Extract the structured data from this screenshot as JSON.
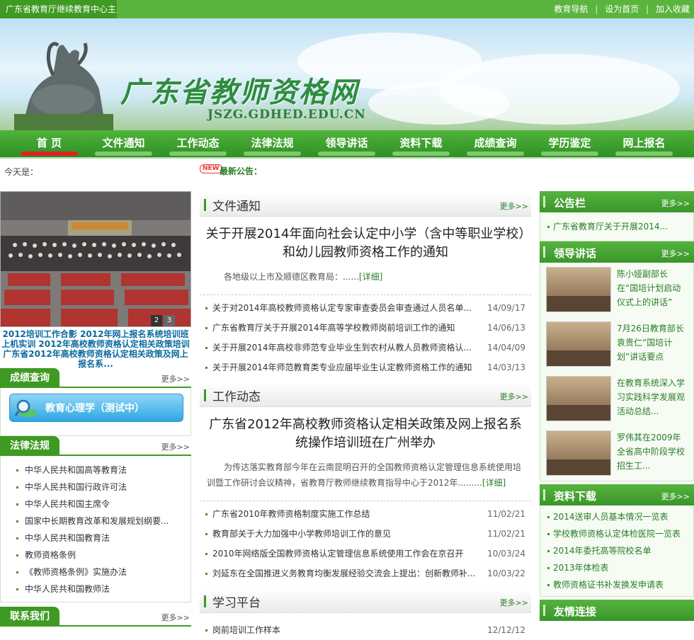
{
  "topbar": {
    "host_text": "广东省教育厅继续教育中心主办",
    "links": [
      "教育导航",
      "设为首页",
      "加入收藏"
    ]
  },
  "banner": {
    "site_name": "广东省教师资格网",
    "site_url": "JSZG.GDHED.EDU.CN"
  },
  "nav": {
    "items": [
      "首 页",
      "文件通知",
      "工作动态",
      "法律法规",
      "领导讲话",
      "资料下载",
      "成绩查询",
      "学历鉴定",
      "网上报名"
    ],
    "active_index": 0
  },
  "info": {
    "today_label": "今天是：",
    "new_badge": "NEW",
    "announcement_label": "最新公告："
  },
  "left": {
    "slide_numbers": [
      "2",
      "3"
    ],
    "slide_caption": "2012培训工作合影 2012年网上报名系统培训班上机实训 2012年高校教师资格认定相关政策培训 广东省2012年高校教师资格认定相关政策及网上报名系...",
    "score": {
      "title": "成绩查询",
      "more": "更多>>",
      "button": "教育心理学（测试中）"
    },
    "law": {
      "title": "法律法规",
      "more": "更多>>",
      "items": [
        "中华人民共和国高等教育法",
        "中华人民共和国行政许可法",
        "中华人民共和国主席令",
        "国家中长期教育改革和发展规划纲要...",
        "中华人民共和国教育法",
        "教师资格条例",
        "《教师资格条例》实施办法",
        "中华人民共和国教师法"
      ]
    },
    "contact_title": "联系我们",
    "contact_more": "更多>>"
  },
  "center": {
    "notice": {
      "title": "文件通知",
      "more": "更多>>",
      "headline": "关于开展2014年面向社会认定中小学（含中等职业学校）和幼儿园教师资格工作的通知",
      "summary": "各地级以上市及顺德区教育局：......",
      "detail": "[详细]",
      "items": [
        {
          "title": "关于对2014年高校教师资格认定专家审查委员会审查通过人员名单...",
          "date": "14/09/17"
        },
        {
          "title": "广东省教育厅关于开展2014年高等学校教师岗前培训工作的通知",
          "date": "14/06/13"
        },
        {
          "title": "关于开展2014年高校非师范专业毕业生到农村从教人员教师资格认...",
          "date": "14/04/09"
        },
        {
          "title": "关于开展2014年师范教育类专业应届毕业生认定教师资格工作的通知",
          "date": "14/03/13"
        }
      ]
    },
    "work": {
      "title": "工作动态",
      "more": "更多>>",
      "headline": "广东省2012年高校教师资格认定相关政策及网上报名系统操作培训班在广州举办",
      "summary": "为传达落实教育部今年在云南昆明召开的全国教师资格认定管理信息系统使用培训暨工作研讨会议精神，省教育厅教师继续教育指导中心于2012年.........",
      "detail": "[详细]",
      "items": [
        {
          "title": "广东省2010年教师资格制度实施工作总结",
          "date": "11/02/21"
        },
        {
          "title": "教育部关于大力加强中小学教师培训工作的意见",
          "date": "11/02/21"
        },
        {
          "title": "2010年网络版全国教师资格认定管理信息系统使用工作会在京召开",
          "date": "10/03/24"
        },
        {
          "title": "刘延东在全国推进义务教育均衡发展经验交流会上提出：创新教师补...",
          "date": "10/03/22"
        }
      ]
    },
    "study": {
      "title": "学习平台",
      "more": "更多>>",
      "first_item": "岗前培训工作样本",
      "first_date": "12/12/12"
    }
  },
  "right": {
    "bulletin": {
      "title": "公告栏",
      "more": "更多>>",
      "items": [
        "广东省教育厅关于开展2014..."
      ]
    },
    "speech": {
      "title": "领导讲话",
      "more": "更多>>",
      "items": [
        "陈小娅副部长在“国培计划启动仪式上的讲话”",
        "7月26日教育部长袁贵仁“国培计划”讲话要点",
        "在教育系统深入学习实践科学发展观活动总结...",
        "罗伟其在2009年全省高中阶段学校招生工..."
      ]
    },
    "download": {
      "title": "资料下载",
      "more": "更多>>",
      "items": [
        "2014送审人员基本情况一览表",
        "学校教师资格认定体检医院一览表",
        "2014年委托高等院校名单",
        "2013年体检表",
        "教师资格证书补发换发申请表"
      ]
    },
    "links_title": "友情连接"
  }
}
